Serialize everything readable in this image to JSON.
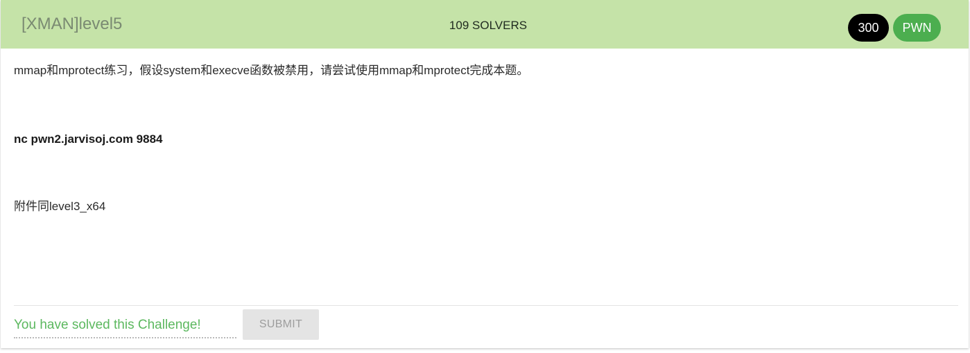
{
  "challenge": {
    "title": "[XMAN]level5",
    "solvers_label": "109 SOLVERS",
    "points": "300",
    "category": "PWN"
  },
  "description": {
    "line1": "mmap和mprotect练习，假设system和execve函数被禁用，请尝试使用mmap和mprotect完成本题。",
    "line2": "nc pwn2.jarvisoj.com 9884",
    "line3": "附件同level3_x64"
  },
  "submission": {
    "placeholder": "You have solved this Challenge!",
    "submit_label": "SUBMIT"
  },
  "colors": {
    "header_bg": "#c5e3a8",
    "points_badge": "#000000",
    "category_badge": "#4cae4f",
    "solved_text": "#5cb85f"
  }
}
